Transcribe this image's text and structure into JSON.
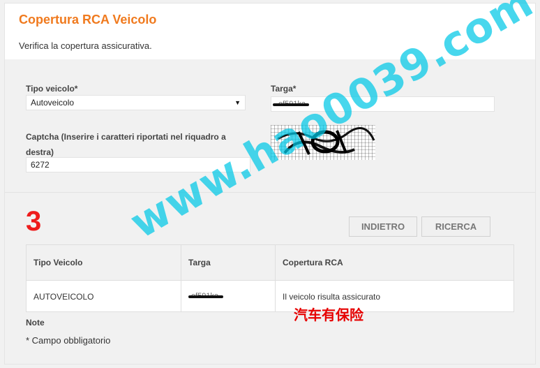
{
  "header": {
    "title": "Copertura RCA Veicolo",
    "subtitle": "Verifica la copertura assicurativa."
  },
  "form": {
    "vehicle_type_label": "Tipo veicolo*",
    "vehicle_type_value": "Autoveicolo",
    "plate_label": "Targa*",
    "plate_value_partial": "ef591ka",
    "captcha_label": "Captcha (Inserire i caratteri riportati nel riquadro a destra)",
    "captcha_value": "6272"
  },
  "annotation": {
    "step_number": "3",
    "caption": "汽车有保险",
    "watermark": "www.hao0039.com"
  },
  "buttons": {
    "back_label": "INDIETRO",
    "search_label": "RICERCA"
  },
  "table": {
    "headers": [
      "Tipo Veicolo",
      "Targa",
      "Copertura RCA"
    ],
    "rows": [
      [
        "AUTOVEICOLO",
        "ef591ka",
        "Il veicolo risulta assicurato"
      ]
    ]
  },
  "notes": {
    "title": "Note",
    "text": "* Campo obbligatorio"
  },
  "colors": {
    "title_orange": "#f07a1e",
    "step_red": "#ee1c1c",
    "caption_red": "#e60000",
    "watermark_cyan": "#00c8e6"
  },
  "icons": {
    "select_arrow": "chevron-down-icon"
  }
}
